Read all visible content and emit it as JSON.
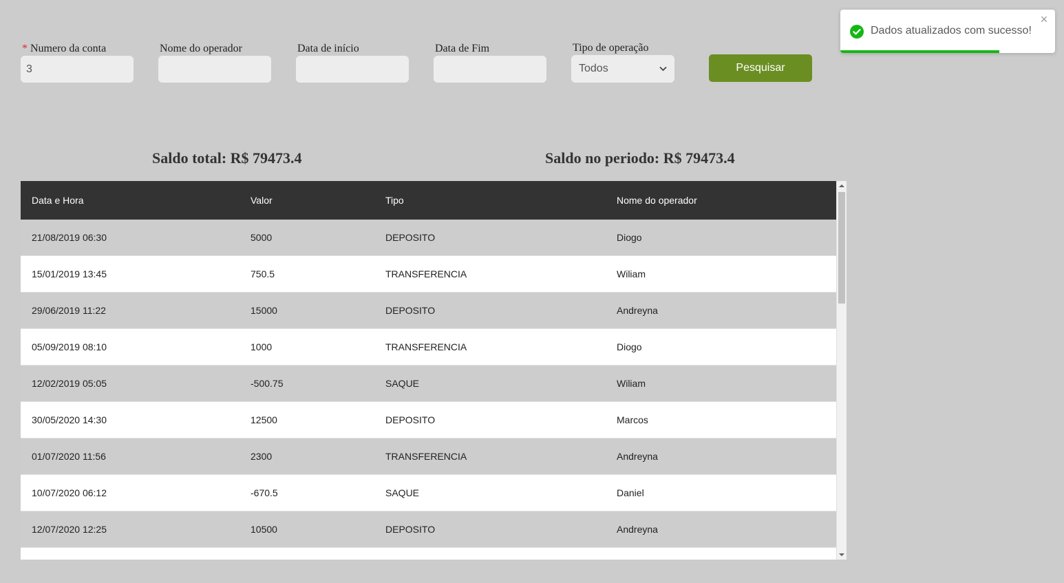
{
  "filters": {
    "account_number": {
      "label": "Numero da conta",
      "required_mark": "*",
      "value": "3"
    },
    "operator_name": {
      "label": "Nome do operador",
      "value": ""
    },
    "start_date": {
      "label": "Data de início",
      "value": ""
    },
    "end_date": {
      "label": "Data de Fim",
      "value": ""
    },
    "operation_type": {
      "label": "Tipo de operação",
      "selected": "Todos"
    },
    "search_button_label": "Pesquisar"
  },
  "balances": {
    "total": "Saldo total: R$ 79473.4",
    "period": "Saldo no periodo: R$ 79473.4"
  },
  "table": {
    "headers": [
      "Data e Hora",
      "Valor",
      "Tipo",
      "Nome do operador"
    ],
    "rows": [
      [
        "21/08/2019 06:30",
        "5000",
        "DEPOSITO",
        "Diogo"
      ],
      [
        "15/01/2019 13:45",
        "750.5",
        "TRANSFERENCIA",
        "Wiliam"
      ],
      [
        "29/06/2019 11:22",
        "15000",
        "DEPOSITO",
        "Andreyna"
      ],
      [
        "05/09/2019 08:10",
        "1000",
        "TRANSFERENCIA",
        "Diogo"
      ],
      [
        "12/02/2019 05:05",
        "-500.75",
        "SAQUE",
        "Wiliam"
      ],
      [
        "30/05/2020 14:30",
        "12500",
        "DEPOSITO",
        "Marcos"
      ],
      [
        "01/07/2020 11:56",
        "2300",
        "TRANSFERENCIA",
        "Andreyna"
      ],
      [
        "10/07/2020 06:12",
        "-670.5",
        "SAQUE",
        "Daniel"
      ],
      [
        "12/07/2020 12:25",
        "10500",
        "DEPOSITO",
        "Andreyna"
      ],
      [
        "",
        "",
        "",
        ""
      ]
    ]
  },
  "toast": {
    "message": "Dados atualizados com sucesso!",
    "progress_fraction": 0.74,
    "icon": "check-circle-icon",
    "close_icon": "close-icon"
  },
  "colors": {
    "page_background": "#cccccc",
    "accent_button": "#6b8e23",
    "table_header": "#333333",
    "required_mark": "#e0282e",
    "success": "#15b715"
  }
}
